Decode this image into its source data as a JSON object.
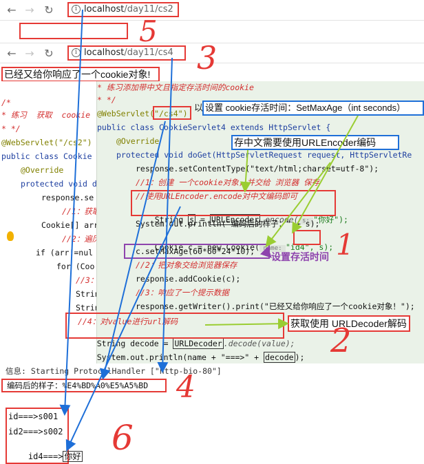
{
  "browser_top": {
    "back": "←",
    "forward": "→",
    "reload": "↻",
    "info": "i",
    "url_host": "localhost",
    "url_path": "/day11/cs2"
  },
  "browser_second": {
    "back": "←",
    "forward": "→",
    "reload": "↻",
    "info": "i",
    "url_host": "localhost",
    "url_path": "/day11/cs4"
  },
  "response_text": "已经又给你响应了一个cookie对象!",
  "annotations": {
    "n5": "5",
    "n3": "3",
    "n1": "1",
    "n2": "2",
    "n4": "4",
    "n6": "6",
    "set_max_age": "设置 cookie存活时间：SetMaxAge（int seconds）",
    "set_max_age_prefix": "以",
    "urlencoder": "存中文需要使用URLEncoder编码",
    "set_alive": "设置存活时间",
    "urldecoder": "获取使用 URLDecoder解码"
  },
  "code_back": {
    "l1": "/*",
    "l2": "* 练习  获取  cookie",
    "l3": "* */",
    "l4": "@WebServlet(\"/cs2\")",
    "l5": "public class Cookie",
    "l6": "@Override",
    "l7": "protected void d",
    "l8": "response.se",
    "l9": "//1：获取",
    "l10": "Cookie[] arr",
    "l11": "//2：遍历",
    "l12": "if (arr!=nul",
    "l13": "for (Coo",
    "l14": "//3：",
    "l15": "Strin",
    "l16": "Strin"
  },
  "code_front": {
    "c1": "* 练习添加带中文且指定存活时间的cookie",
    "c2": "* */",
    "c3": "@WebServlet(\"/cs4\")",
    "c4": "public class CookieServlet4 extends HttpServlet {",
    "c5": "@Override",
    "c6": "protected void doGet(HttpServletRequest request, HttpServletRe",
    "c7": "response.setContentType(\"text/html;charset=utf-8\");",
    "c8": "//1：创建 一个cookie对象，并交给 浏览器 保存",
    "c9": "//使用URLEncoder.encode对中文编码即可",
    "c10a": "String ",
    "c10b": "s",
    "c10c": " = ",
    "c10d": "URLEncoder",
    "c10e": ".encode(",
    "c10f": " s: ",
    "c10g": "\"你好\");",
    "c11": "System.out.println(\"编码后的样子：\" + s);",
    "c12a": "Cookie c = new Cookie(",
    "c12b": " name: ",
    "c12c": "\"id4\", s);",
    "c13": "c.setMaxAge(60*60*24*10);",
    "c14": "//2：把对象交给浏览器保存",
    "c15": "response.addCookie(c);",
    "c16": "//3：响应了一个提示数据",
    "c17": "response.getWriter().print(\"已经又给你响应了一个cookie对象！\");",
    "c18": "//4：对value进行url解码",
    "c19a": "String decode = ",
    "c19b": "URLDecoder",
    "c19c": ".decode(value);",
    "c20a": "System.out.println(name + \"===>\" + ",
    "c20b": "decode",
    "c20c": ");"
  },
  "console": {
    "info": "信息: Starting ProtocolHandler [\"http-bio-80\"]",
    "encoded": "编码后的样子：%E4%BD%A0%E5%A5%BD",
    "out1": "id===>s001",
    "out2": "id2===>s002",
    "out3a": "id4===>",
    "out3b": "你好"
  },
  "colors": {
    "red": "#e53935",
    "blue": "#1e6fd8",
    "green": "#9acd32",
    "purple": "#8e44ad",
    "code_bg": "#eaf2e8"
  }
}
